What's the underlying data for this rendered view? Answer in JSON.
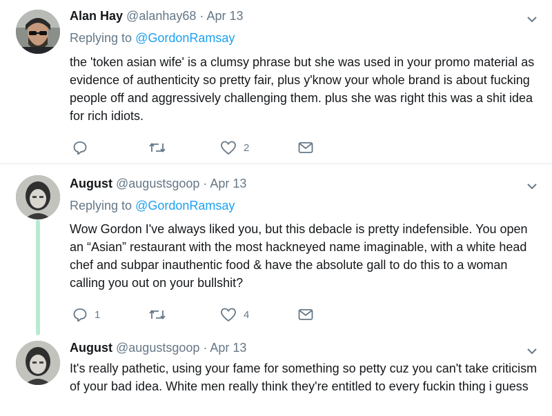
{
  "tweets": [
    {
      "name": "Alan Hay",
      "handle": "@alanhay68",
      "separator": "·",
      "date": "Apr 13",
      "replying_prefix": "Replying to",
      "replying_to": "@GordonRamsay",
      "text": "the 'token asian wife' is a clumsy phrase but she was used in your promo material as evidence of authenticity so pretty fair, plus y'know your whole brand is about fucking people off and aggressively challenging them. plus she was right this was a shit idea for rich idiots.",
      "replies": "",
      "retweets": "",
      "likes": "2"
    },
    {
      "name": "August",
      "handle": "@augustsgoop",
      "separator": "·",
      "date": "Apr 13",
      "replying_prefix": "Replying to",
      "replying_to": "@GordonRamsay",
      "text": "Wow Gordon I've always liked you, but this debacle is pretty indefensible. You open an “Asian” restaurant with the most hackneyed name imaginable, with a white head chef and subpar inauthentic food & have the absolute gall to do this to a woman calling you out on your bullshit?",
      "replies": "1",
      "retweets": "",
      "likes": "4"
    },
    {
      "name": "August",
      "handle": "@augustsgoop",
      "separator": "·",
      "date": "Apr 13",
      "text": "It's really pathetic, using your fame for something so petty cuz you can't take criticism of your bad idea. White men really think they're entitled to every fuckin thing i guess"
    }
  ],
  "icons": {
    "reply": "reply-icon",
    "retweet": "retweet-icon",
    "like": "heart-icon",
    "message": "envelope-icon",
    "menu": "chevron-down-icon"
  },
  "colors": {
    "link": "#1da1f2",
    "secondary": "#657786",
    "thread_line": "#b8ead2",
    "divider": "#e1e8ed"
  }
}
